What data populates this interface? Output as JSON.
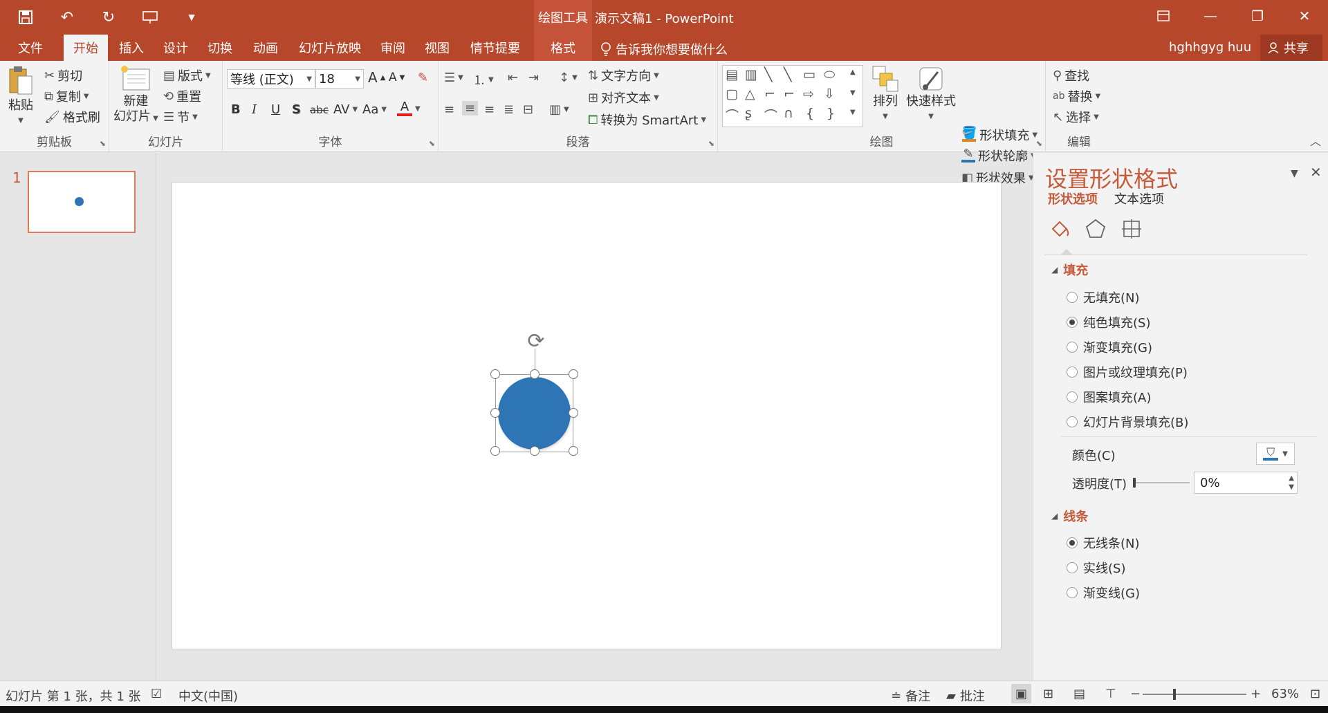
{
  "titlebar": {
    "tool_context": "绘图工具",
    "doc_title": "演示文稿1 - PowerPoint",
    "qat_icons": [
      "save-icon",
      "undo-icon",
      "redo-icon",
      "slideshow-icon",
      "customize-icon"
    ]
  },
  "tabs": {
    "file": "文件",
    "home": "开始",
    "insert": "插入",
    "design": "设计",
    "transitions": "切换",
    "animations": "动画",
    "slideshow": "幻灯片放映",
    "review": "审阅",
    "view": "视图",
    "storyboard": "情节提要",
    "format": "格式",
    "tell_me": "告诉我你想要做什么",
    "user": "hghhgyg huu",
    "share": "共享"
  },
  "ribbon": {
    "clipboard": {
      "label": "剪贴板",
      "paste": "粘贴",
      "cut": "剪切",
      "copy": "复制",
      "format_painter": "格式刷"
    },
    "slides": {
      "label": "幻灯片",
      "new_slide_1": "新建",
      "new_slide_2": "幻灯片",
      "layout": "版式",
      "reset": "重置",
      "section": "节"
    },
    "font": {
      "label": "字体",
      "font_name": "等线 (正文)",
      "font_size": "18",
      "bold": "B",
      "italic": "I",
      "underline": "U",
      "shadow": "S",
      "strike": "abc",
      "spacing": "AV",
      "case": "Aa",
      "color": "A",
      "grow": "A",
      "shrink": "A"
    },
    "paragraph": {
      "label": "段落",
      "text_direction": "文字方向",
      "align_text": "对齐文本",
      "smartart": "转换为 SmartArt"
    },
    "drawing": {
      "label": "绘图",
      "arrange": "排列",
      "quick_styles": "快速样式",
      "shape_fill": "形状填充",
      "shape_outline": "形状轮廓",
      "shape_effects": "形状效果"
    },
    "editing": {
      "label": "编辑",
      "find": "查找",
      "replace": "替换",
      "select": "选择"
    }
  },
  "slides_panel": {
    "slide_number": "1"
  },
  "format_pane": {
    "title": "设置形状格式",
    "tab_shape": "形状选项",
    "tab_text": "文本选项",
    "fill_section": "填充",
    "fill_options": [
      {
        "label": "无填充(N)",
        "selected": false
      },
      {
        "label": "纯色填充(S)",
        "selected": true
      },
      {
        "label": "渐变填充(G)",
        "selected": false
      },
      {
        "label": "图片或纹理填充(P)",
        "selected": false
      },
      {
        "label": "图案填充(A)",
        "selected": false
      },
      {
        "label": "幻灯片背景填充(B)",
        "selected": false
      }
    ],
    "color_label": "颜色(C)",
    "transparency_label": "透明度(T)",
    "transparency_value": "0%",
    "line_section": "线条",
    "line_options": [
      {
        "label": "无线条(N)",
        "selected": true
      },
      {
        "label": "实线(S)",
        "selected": false
      },
      {
        "label": "渐变线(G)",
        "selected": false
      }
    ]
  },
  "statusbar": {
    "slide_info": "幻灯片 第 1 张，共 1 张",
    "language": "中文(中国)",
    "notes": "备注",
    "comments": "批注",
    "zoom": "63%"
  },
  "colors": {
    "accent": "#b7472a",
    "shape_fill": "#2e75b6"
  }
}
